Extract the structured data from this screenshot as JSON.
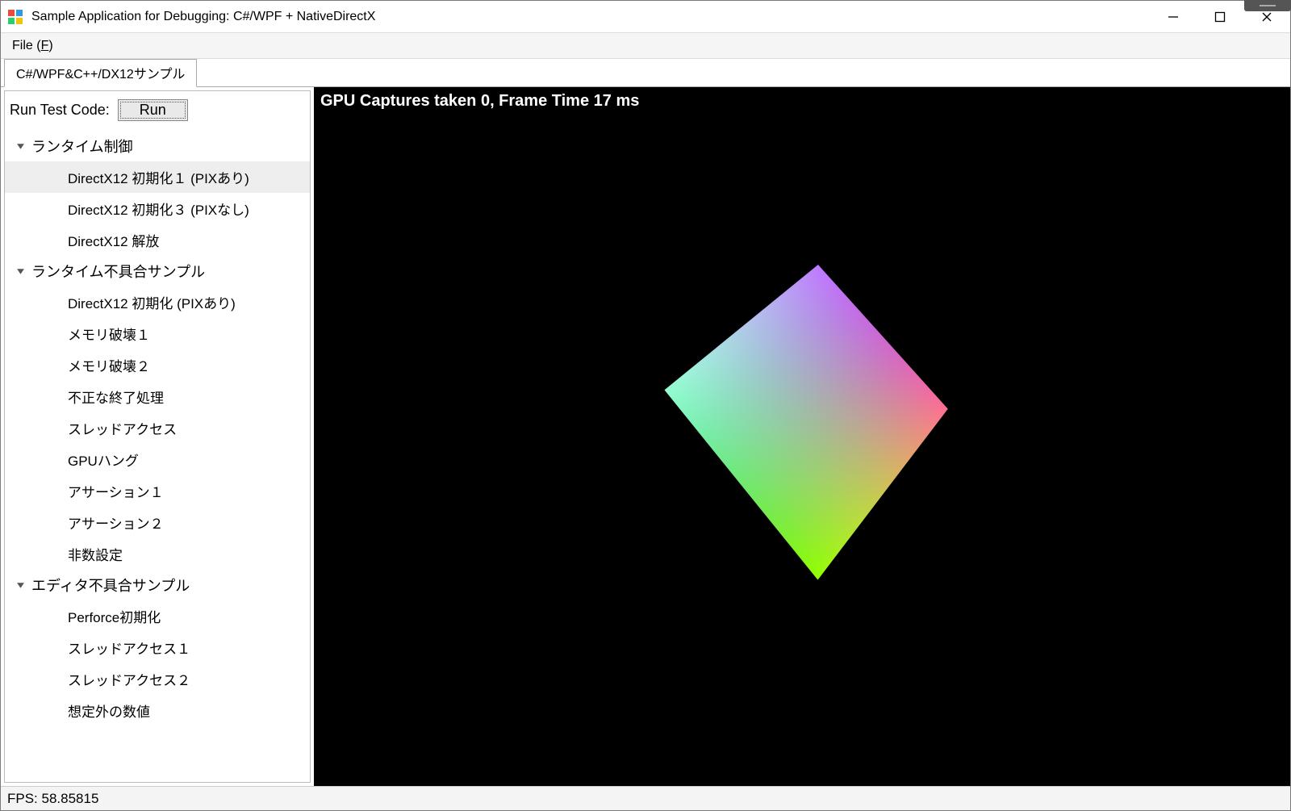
{
  "window": {
    "title": "Sample Application for Debugging: C#/WPF + NativeDirectX"
  },
  "menu": {
    "file_prefix": "File (",
    "file_key": "F",
    "file_suffix": ")"
  },
  "tabs": {
    "active": "C#/WPF&C++/DX12サンプル"
  },
  "run": {
    "label": "Run Test Code:",
    "button": "Run"
  },
  "tree": {
    "groups": [
      {
        "label": "ランタイム制御",
        "items": [
          {
            "label": "DirectX12 初期化１ (PIXあり)",
            "selected": true
          },
          {
            "label": "DirectX12 初期化３ (PIXなし)",
            "selected": false
          },
          {
            "label": "DirectX12 解放",
            "selected": false
          }
        ]
      },
      {
        "label": "ランタイム不具合サンプル",
        "items": [
          {
            "label": "DirectX12 初期化 (PIXあり)",
            "selected": false
          },
          {
            "label": "メモリ破壊１",
            "selected": false
          },
          {
            "label": "メモリ破壊２",
            "selected": false
          },
          {
            "label": "不正な終了処理",
            "selected": false
          },
          {
            "label": "スレッドアクセス",
            "selected": false
          },
          {
            "label": "GPUハング",
            "selected": false
          },
          {
            "label": "アサーション１",
            "selected": false
          },
          {
            "label": "アサーション２",
            "selected": false
          },
          {
            "label": "非数設定",
            "selected": false
          }
        ]
      },
      {
        "label": "エディタ不具合サンプル",
        "items": [
          {
            "label": "Perforce初期化",
            "selected": false
          },
          {
            "label": "スレッドアクセス１",
            "selected": false
          },
          {
            "label": "スレッドアクセス２",
            "selected": false
          },
          {
            "label": "想定外の数値",
            "selected": false
          }
        ]
      }
    ]
  },
  "viewport": {
    "overlay": "GPU Captures taken 0, Frame Time 17 ms"
  },
  "status": {
    "fps": "FPS: 58.85815"
  }
}
